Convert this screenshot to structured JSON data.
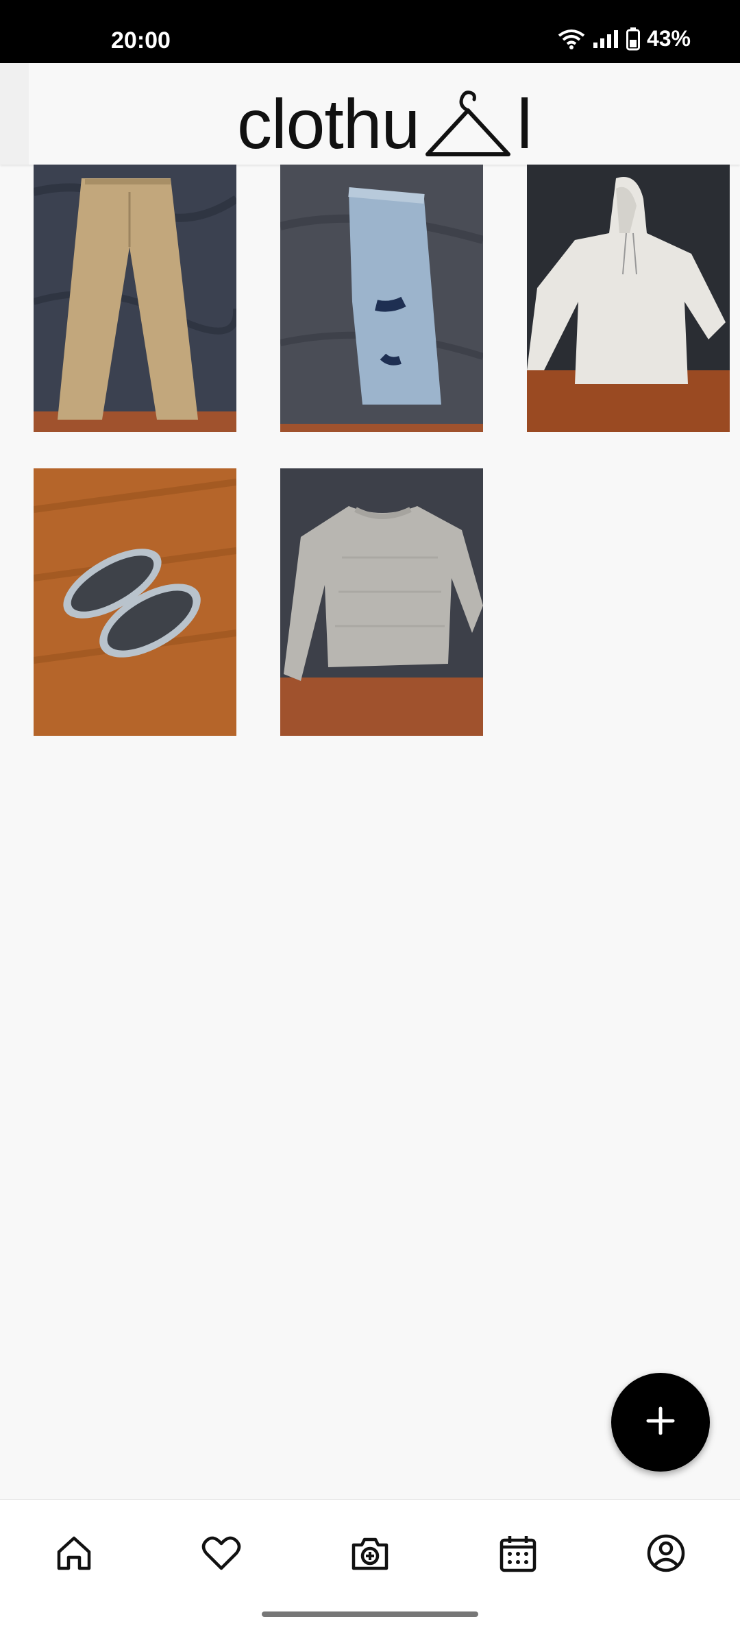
{
  "status_bar": {
    "time": "20:00",
    "battery": "43%",
    "icons": [
      "wifi-icon",
      "signal-icon",
      "battery-icon"
    ]
  },
  "header": {
    "logo_text_left": "clothu",
    "logo_text_right": "l",
    "logo_icon": "hanger-icon"
  },
  "grid": {
    "items": [
      {
        "name": "khaki pants"
      },
      {
        "name": "ripped denim shorts"
      },
      {
        "name": "white hoodie"
      },
      {
        "name": "slippers"
      },
      {
        "name": "grey knit sweater"
      }
    ]
  },
  "fab": {
    "icon": "plus-icon"
  },
  "bottom_nav": {
    "items": [
      {
        "icon": "home-icon"
      },
      {
        "icon": "heart-icon"
      },
      {
        "icon": "camera-add-icon"
      },
      {
        "icon": "calendar-icon"
      },
      {
        "icon": "profile-icon"
      }
    ]
  },
  "colors": {
    "background": "#f8f8f8",
    "fab": "#000000",
    "status_bar": "#000000"
  }
}
